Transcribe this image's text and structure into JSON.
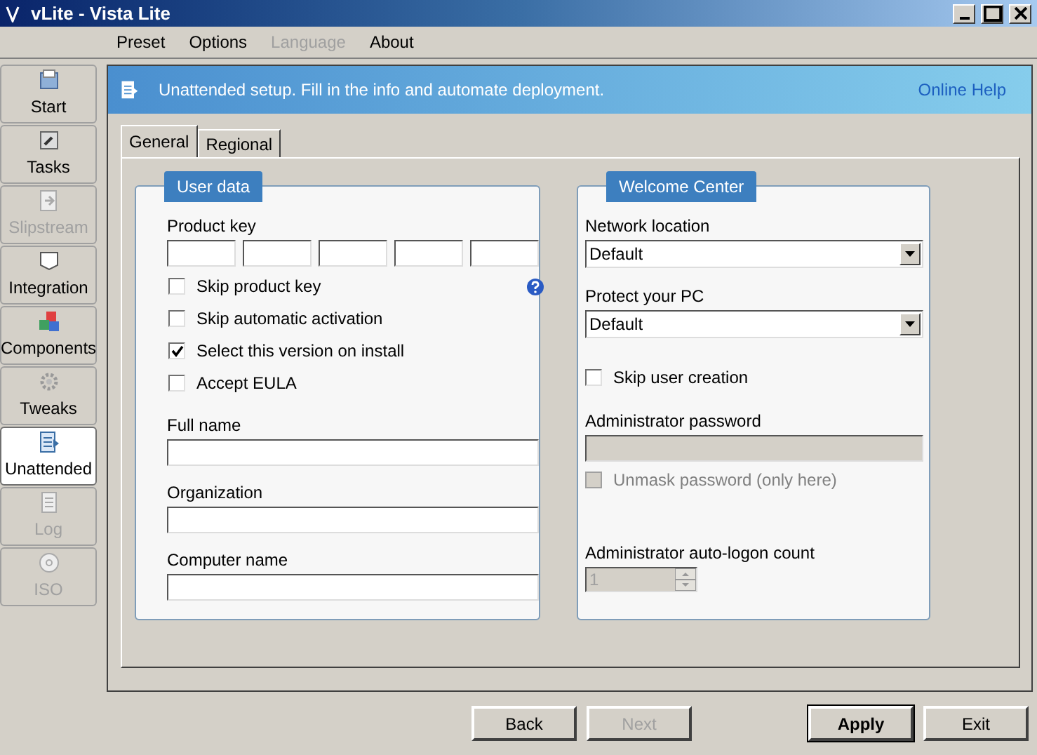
{
  "window": {
    "title": "vLite - Vista Lite"
  },
  "menu": [
    {
      "label": "Preset",
      "disabled": false
    },
    {
      "label": "Options",
      "disabled": false
    },
    {
      "label": "Language",
      "disabled": true
    },
    {
      "label": "About",
      "disabled": false
    }
  ],
  "sidebar": {
    "items": [
      {
        "label": "Start",
        "selected": false,
        "disabled": false
      },
      {
        "label": "Tasks",
        "selected": false,
        "disabled": false
      },
      {
        "label": "Slipstream",
        "selected": false,
        "disabled": true
      },
      {
        "label": "Integration",
        "selected": false,
        "disabled": false
      },
      {
        "label": "Components",
        "selected": false,
        "disabled": false
      },
      {
        "label": "Tweaks",
        "selected": false,
        "disabled": false
      },
      {
        "label": "Unattended",
        "selected": true,
        "disabled": false
      },
      {
        "label": "Log",
        "selected": false,
        "disabled": true
      },
      {
        "label": "ISO",
        "selected": false,
        "disabled": true
      }
    ]
  },
  "header": {
    "text": "Unattended setup. Fill in the info and automate deployment.",
    "link": "Online Help"
  },
  "tabs": [
    {
      "label": "General",
      "selected": true
    },
    {
      "label": "Regional",
      "selected": false
    }
  ],
  "user_data": {
    "title": "User data",
    "product_key": {
      "label": "Product key"
    },
    "checkboxes": [
      {
        "label": "Skip product key",
        "checked": false
      },
      {
        "label": "Skip automatic activation",
        "checked": false
      },
      {
        "label": "Select this version on install",
        "checked": true
      },
      {
        "label": "Accept EULA",
        "checked": false
      }
    ],
    "fields": [
      {
        "label": "Full name"
      },
      {
        "label": "Organization"
      },
      {
        "label": "Computer name"
      }
    ]
  },
  "welcome_center": {
    "title": "Welcome Center",
    "items": [
      {
        "kind": "select",
        "label": "Network location",
        "value": "Default"
      },
      {
        "kind": "select",
        "label": "Protect your PC",
        "value": "Default"
      },
      {
        "kind": "checkbox",
        "label": "Skip user creation",
        "checked": false,
        "disabled": false
      },
      {
        "kind": "password",
        "label": "Administrator password",
        "disabled": true
      },
      {
        "kind": "checkbox",
        "label": "Unmask password (only here)",
        "checked": false,
        "disabled": true
      },
      {
        "kind": "spin",
        "label": "Administrator auto-logon count",
        "value": "1",
        "disabled": true
      }
    ]
  },
  "buttons": [
    {
      "label": "Back",
      "disabled": false,
      "default": false
    },
    {
      "label": "Next",
      "disabled": true,
      "default": false
    },
    {
      "label": "Apply",
      "disabled": false,
      "default": true
    },
    {
      "label": "Exit",
      "disabled": false,
      "default": false
    }
  ]
}
